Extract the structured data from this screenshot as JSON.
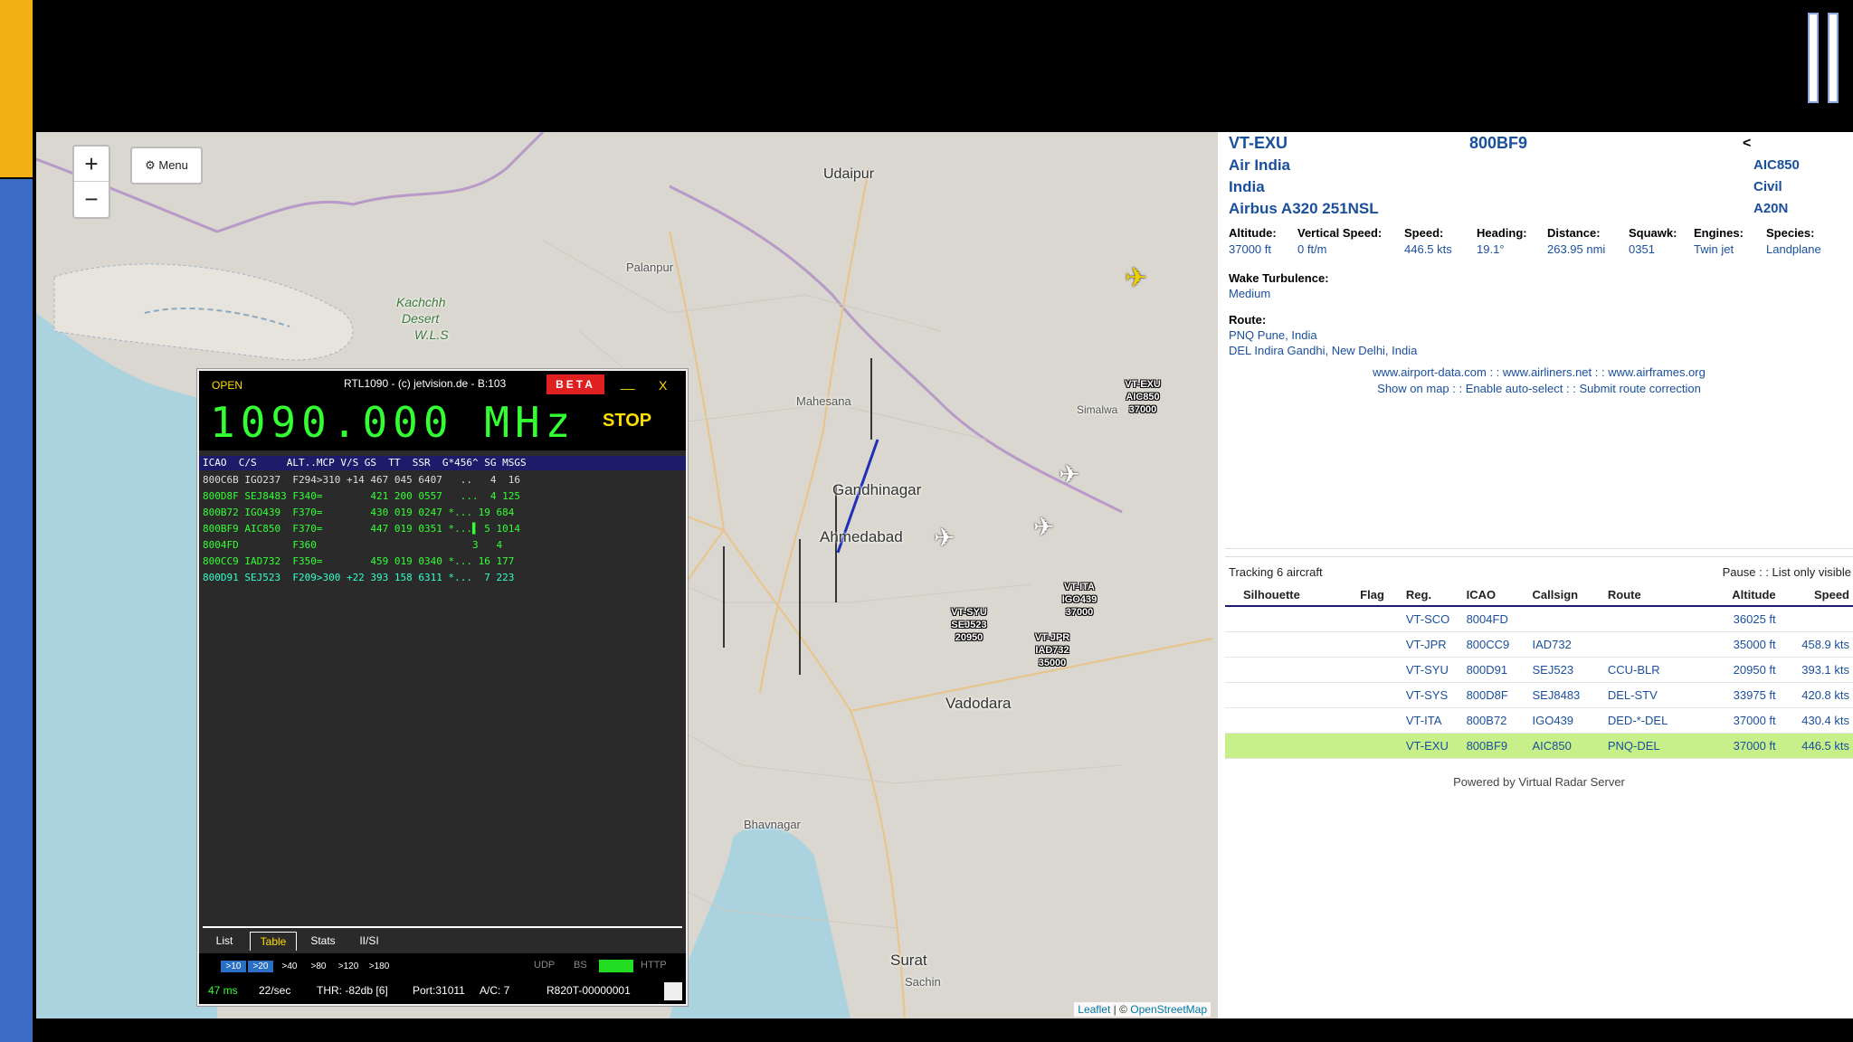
{
  "map": {
    "zoom_in": "+",
    "zoom_out": "−",
    "menu_label": "Menu",
    "places": {
      "udaipur": "Udaipur",
      "palanpur": "Palanpur",
      "kachchh1": "Kachchh",
      "kachchh2": "Desert",
      "kachchh3": "W.L.S",
      "mahesana": "Mahesana",
      "simalwa": "Simalwa",
      "gandhinagar": "Gandhinagar",
      "ahmedabad": "Ahmedabad",
      "vadodara": "Vadodara",
      "bhavnagar": "Bhavnagar",
      "surat": "Surat",
      "sachin": "Sachin"
    },
    "attribution_leaflet": "Leaflet",
    "attribution_sep": " | © ",
    "attribution_osm": "OpenStreetMap",
    "aircraft_labels": [
      {
        "reg": "VT-EXU",
        "callsign": "AIC850",
        "alt": "37000"
      },
      {
        "reg": "VT-ITA",
        "callsign": "IGO439",
        "alt": "37000"
      },
      {
        "reg": "VT-SYU",
        "callsign": "SEJ523",
        "alt": "20950"
      },
      {
        "reg": "VT-JPR",
        "callsign": "IAD732",
        "alt": "35000"
      }
    ]
  },
  "rtl": {
    "open": "OPEN",
    "title": "RTL1090 - (c) jetvision.de - B:103",
    "beta": "BETA",
    "minimize": "__",
    "close": "X",
    "frequency": "1090.000 MHz",
    "stop": "STOP",
    "header": "ICAO  C/S     ALT..MCP V/S GS  TT  SSR  G*456^ SG MSGS",
    "rows": [
      {
        "text": "800C6B IGO237  F294>310 +14 467 045 6407   ..   4  16",
        "color": "#dddddd"
      },
      {
        "text": "800D8F SEJ8483 F340=        421 200 0557   ...  4 125",
        "color": "#33ff33"
      },
      {
        "text": "800B72 IGO439  F370=        430 019 0247 *... 19 684",
        "color": "#33ff33"
      },
      {
        "text": "800BF9 AIC850  F370=        447 019 0351 *...▌ 5 1014",
        "color": "#33ff33"
      },
      {
        "text": "8004FD         F360                          3   4",
        "color": "#33ff33"
      },
      {
        "text": "800CC9 IAD732  F350=        459 019 0340 *... 16 177",
        "color": "#33ff33"
      },
      {
        "text": "800D91 SEJ523  F209>300 +22 393 158 6311 *...  7 223",
        "color": "#33ffcc"
      }
    ],
    "tabs": [
      "List",
      "Table",
      "Stats",
      "II/SI"
    ],
    "ranges": [
      ">10",
      ">20",
      ">40",
      ">80",
      ">120",
      ">180"
    ],
    "udp": "UDP",
    "bs": "BS",
    "http": "HTTP",
    "ms": "47 ms",
    "rate": "22/sec",
    "thr": "THR: -82db [6]",
    "port": "Port:31011",
    "ac": "A/C: 7",
    "device": "R820T-00000001"
  },
  "detail": {
    "registration": "VT-EXU",
    "icao": "800BF9",
    "back_arrow": "<",
    "operator": "Air India",
    "callsign": "AIC850",
    "country": "India",
    "species_class": "Civil",
    "type": "Airbus A320 251NSL",
    "type_code": "A20N",
    "fields": [
      {
        "k": "Altitude:",
        "v": "37000 ft"
      },
      {
        "k": "Vertical Speed:",
        "v": "0 ft/m"
      },
      {
        "k": "Speed:",
        "v": "446.5 kts"
      },
      {
        "k": "Heading:",
        "v": "19.1°"
      },
      {
        "k": "Distance:",
        "v": "263.95 nmi"
      },
      {
        "k": "Squawk:",
        "v": "0351"
      },
      {
        "k": "Engines:",
        "v": "Twin jet"
      },
      {
        "k": "Species:",
        "v": "Landplane"
      }
    ],
    "wake_label": "Wake Turbulence:",
    "wake_value": "Medium",
    "route_label": "Route:",
    "route_from": "PNQ Pune, India",
    "route_to": "DEL Indira Gandhi, New Delhi, India",
    "links1": "www.airport-data.com : : www.airliners.net : : www.airframes.org",
    "links2": "Show on map : : Enable auto-select : : Submit route correction"
  },
  "list": {
    "tracking": "Tracking 6 aircraft",
    "pause": "Pause : : List only visible",
    "columns": [
      "Silhouette",
      "Flag",
      "Reg.",
      "ICAO",
      "Callsign",
      "Route",
      "Altitude",
      "Speed"
    ],
    "rows": [
      {
        "reg": "VT-SCO",
        "icao": "8004FD",
        "callsign": "",
        "route": "",
        "alt": "36025 ft",
        "speed": ""
      },
      {
        "reg": "VT-JPR",
        "icao": "800CC9",
        "callsign": "IAD732",
        "route": "",
        "alt": "35000 ft",
        "speed": "458.9 kts"
      },
      {
        "reg": "VT-SYU",
        "icao": "800D91",
        "callsign": "SEJ523",
        "route": "CCU-BLR",
        "alt": "20950 ft",
        "speed": "393.1 kts"
      },
      {
        "reg": "VT-SYS",
        "icao": "800D8F",
        "callsign": "SEJ8483",
        "route": "DEL-STV",
        "alt": "33975 ft",
        "speed": "420.8 kts"
      },
      {
        "reg": "VT-ITA",
        "icao": "800B72",
        "callsign": "IGO439",
        "route": "DED-*-DEL",
        "alt": "37000 ft",
        "speed": "430.4 kts"
      },
      {
        "reg": "VT-EXU",
        "icao": "800BF9",
        "callsign": "AIC850",
        "route": "PNQ-DEL",
        "alt": "37000 ft",
        "speed": "446.5 kts"
      }
    ],
    "selected_index": 5,
    "powered": "Powered by Virtual Radar Server"
  }
}
